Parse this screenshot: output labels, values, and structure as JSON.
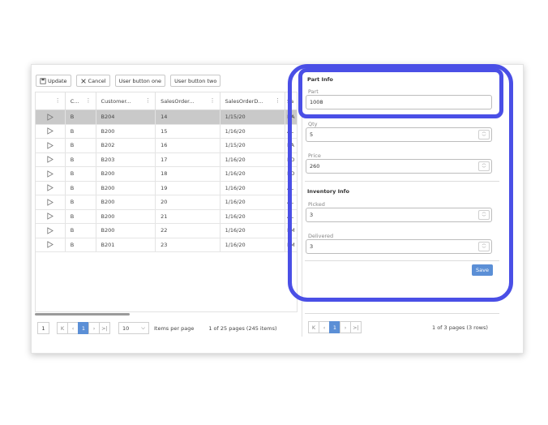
{
  "toolbar": {
    "update": "Update",
    "cancel": "Cancel",
    "user1": "User button one",
    "user2": "User button two"
  },
  "grid": {
    "headers": [
      "C...",
      "Customer...",
      "SalesOrder...",
      "SalesOrderD...",
      "Sa"
    ],
    "rows": [
      [
        "B",
        "B204",
        "14",
        "1/15/20",
        "HA"
      ],
      [
        "B",
        "B200",
        "15",
        "1/16/20",
        "AL"
      ],
      [
        "B",
        "B202",
        "16",
        "1/15/20",
        "BA"
      ],
      [
        "B",
        "B203",
        "17",
        "1/16/20",
        "BO"
      ],
      [
        "B",
        "B200",
        "18",
        "1/16/20",
        "BO"
      ],
      [
        "B",
        "B200",
        "19",
        "1/16/20",
        "AL"
      ],
      [
        "B",
        "B200",
        "20",
        "1/16/20",
        "AL"
      ],
      [
        "B",
        "B200",
        "21",
        "1/16/20",
        "AL"
      ],
      [
        "B",
        "B200",
        "22",
        "1/16/20",
        "EM"
      ],
      [
        "B",
        "B201",
        "23",
        "1/16/20",
        "EM"
      ]
    ]
  },
  "pager_left": {
    "first_box": "1",
    "current_page": "1",
    "page_size": "10",
    "items_per_page": "Items per page",
    "summary": "1 of 25 pages (245 items)"
  },
  "form": {
    "part_info_title": "Part Info",
    "part_label": "Part",
    "part_value": "1008",
    "qty_label": "Qty",
    "qty_value": "5",
    "price_label": "Price",
    "price_value": "260",
    "inventory_title": "Inventory Info",
    "picked_label": "Picked",
    "picked_value": "3",
    "delivered_label": "Delivered",
    "delivered_value": "3",
    "save": "Save"
  },
  "pager_right": {
    "current_page": "1",
    "summary": "1 of 3 pages (3 rows)"
  },
  "colors": {
    "highlight": "#4a4fe6",
    "accent": "#5b8fd6",
    "selected_row": "#c9c9c9"
  }
}
